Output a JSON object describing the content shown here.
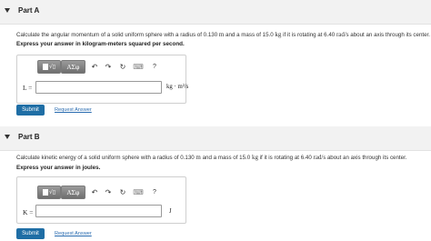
{
  "part_a": {
    "title": "Part A",
    "question_pre": "Calculate the angular momentum of a solid uniform sphere with a radius of 0.130 ",
    "unit_m": "m",
    "question_mid": " and a mass of 15.0 ",
    "unit_kg": "kg",
    "question_mid2": " if it is rotating at 6.40 ",
    "unit_rad_s": "rad/s",
    "question_post": " about an axis through its center.",
    "instruction": "Express your answer in kilogram-meters squared per second.",
    "toolbar": {
      "templates_glyph": "√▯",
      "greek_label": "ΑΣφ",
      "undo": "↶",
      "redo": "↷",
      "reset": "↻",
      "keyboard": "⌨",
      "help": "?"
    },
    "variable": "L =",
    "input_value": "",
    "units": "kg · m²/s",
    "submit_label": "Submit",
    "request_answer": "Request Answer"
  },
  "part_b": {
    "title": "Part B",
    "question_pre": "Calculate kinetic energy of a solid uniform sphere with a radius of 0.130 ",
    "unit_m": "m",
    "question_mid": " and a mass of 15.0 ",
    "unit_kg": "kg",
    "question_mid2": " if it is rotating at 6.40 ",
    "unit_rad_s": "rad/s",
    "question_post": " about an axis through its center.",
    "instruction": "Express your answer in joules.",
    "toolbar": {
      "templates_glyph": "√▯",
      "greek_label": "ΑΣφ",
      "undo": "↶",
      "redo": "↷",
      "reset": "↻",
      "keyboard": "⌨",
      "help": "?"
    },
    "variable": "K =",
    "input_value": "",
    "units": "J",
    "submit_label": "Submit",
    "request_answer": "Request Answer"
  },
  "colors": {
    "submit_bg": "#1f6ea5",
    "link": "#2a6cb0",
    "header_bg": "#f2f2f2"
  },
  "icons": [
    "caret-down-icon",
    "templates-icon",
    "undo-icon",
    "redo-icon",
    "reset-icon",
    "keyboard-icon",
    "help-icon"
  ]
}
